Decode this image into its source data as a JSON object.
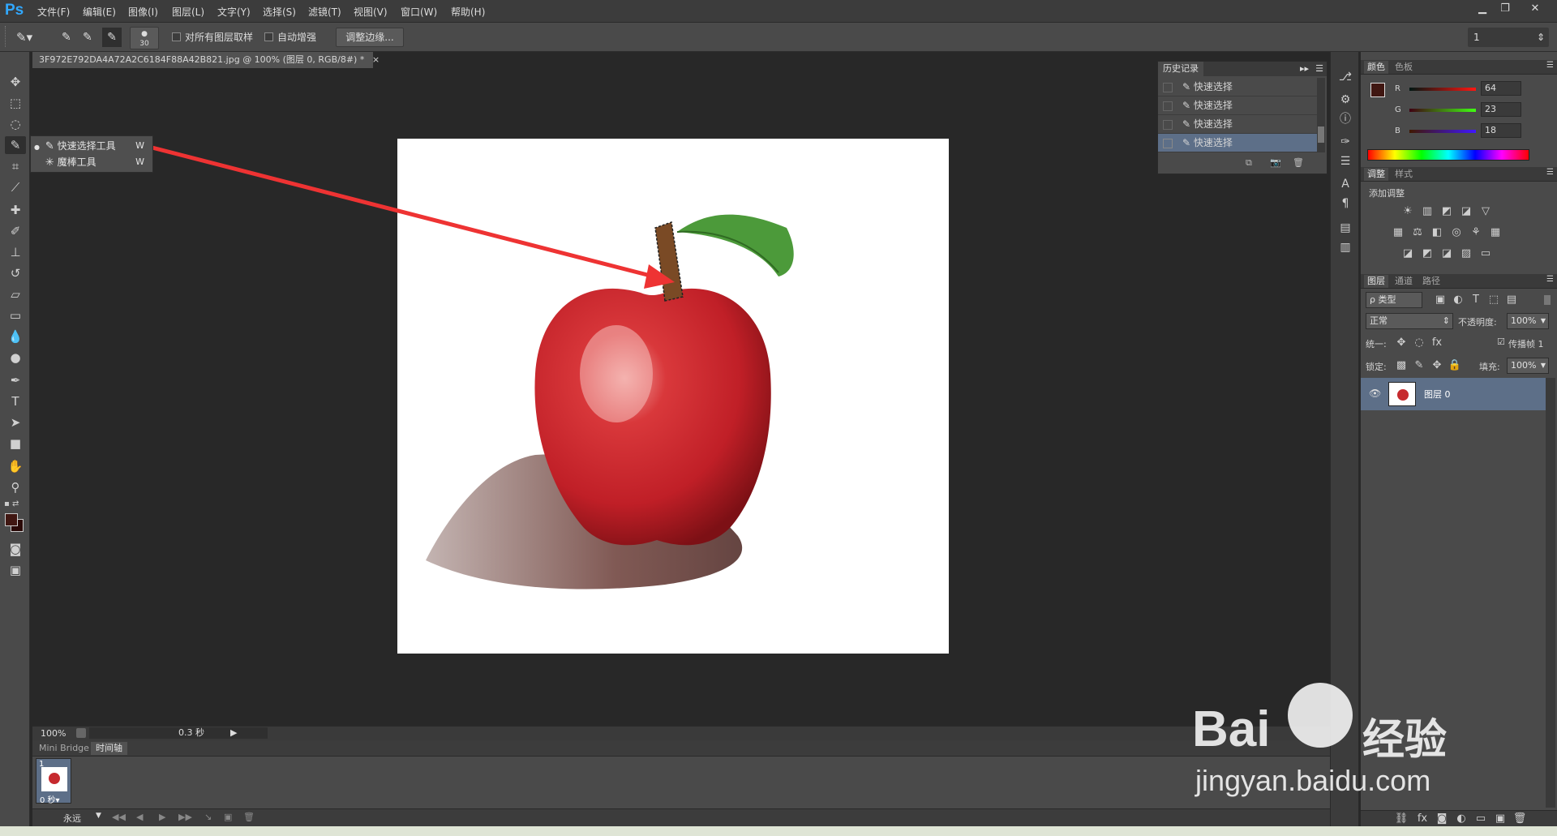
{
  "app": {
    "logo": "Ps",
    "menus": [
      "文件(F)",
      "编辑(E)",
      "图像(I)",
      "图层(L)",
      "文字(Y)",
      "选择(S)",
      "滤镜(T)",
      "视图(V)",
      "窗口(W)",
      "帮助(H)"
    ]
  },
  "options": {
    "brush_size": "30",
    "sample_all_layers": "对所有图层取样",
    "auto_enhance": "自动增强",
    "refine_edge": "调整边缘...",
    "workspace": "1"
  },
  "document": {
    "tab_title": "3F972E792DA4A72A2C6184F88A42B821.jpg @ 100% (图层 0, RGB/8#) *",
    "close": "×"
  },
  "tool_flyout": {
    "items": [
      {
        "label": "快速选择工具",
        "key": "W",
        "selected": true
      },
      {
        "label": "魔棒工具",
        "key": "W",
        "selected": false
      }
    ]
  },
  "status": {
    "zoom": "100%",
    "time": "0.3 秒"
  },
  "bottom_panel": {
    "tabs": [
      "Mini Bridge",
      "时间轴"
    ],
    "frame_number": "1",
    "frame_delay": "0 秒▾",
    "loop": "永远"
  },
  "history": {
    "title": "历史记录",
    "items": [
      "快速选择",
      "快速选择",
      "快速选择",
      "快速选择"
    ]
  },
  "color_panel": {
    "tabs": [
      "颜色",
      "色板"
    ],
    "r_label": "R",
    "r_value": "64",
    "g_label": "G",
    "g_value": "23",
    "b_label": "B",
    "b_value": "18",
    "foreground": "#401712"
  },
  "adjust_panel": {
    "tabs": [
      "调整",
      "样式"
    ],
    "header": "添加调整"
  },
  "layers_panel": {
    "tabs": [
      "图层",
      "通道",
      "路径"
    ],
    "filter_kind": "ρ 类型",
    "blend_mode": "正常",
    "opacity_label": "不透明度:",
    "opacity_value": "100%",
    "unify_label": "统一:",
    "propagate_label": "传播帧 1",
    "lock_label": "锁定:",
    "fill_label": "填充:",
    "fill_value": "100%",
    "layer_name": "图层 0"
  },
  "watermark": {
    "brand": "Bai",
    "brand_cn": "经验",
    "url": "jingyan.baidu.com"
  }
}
